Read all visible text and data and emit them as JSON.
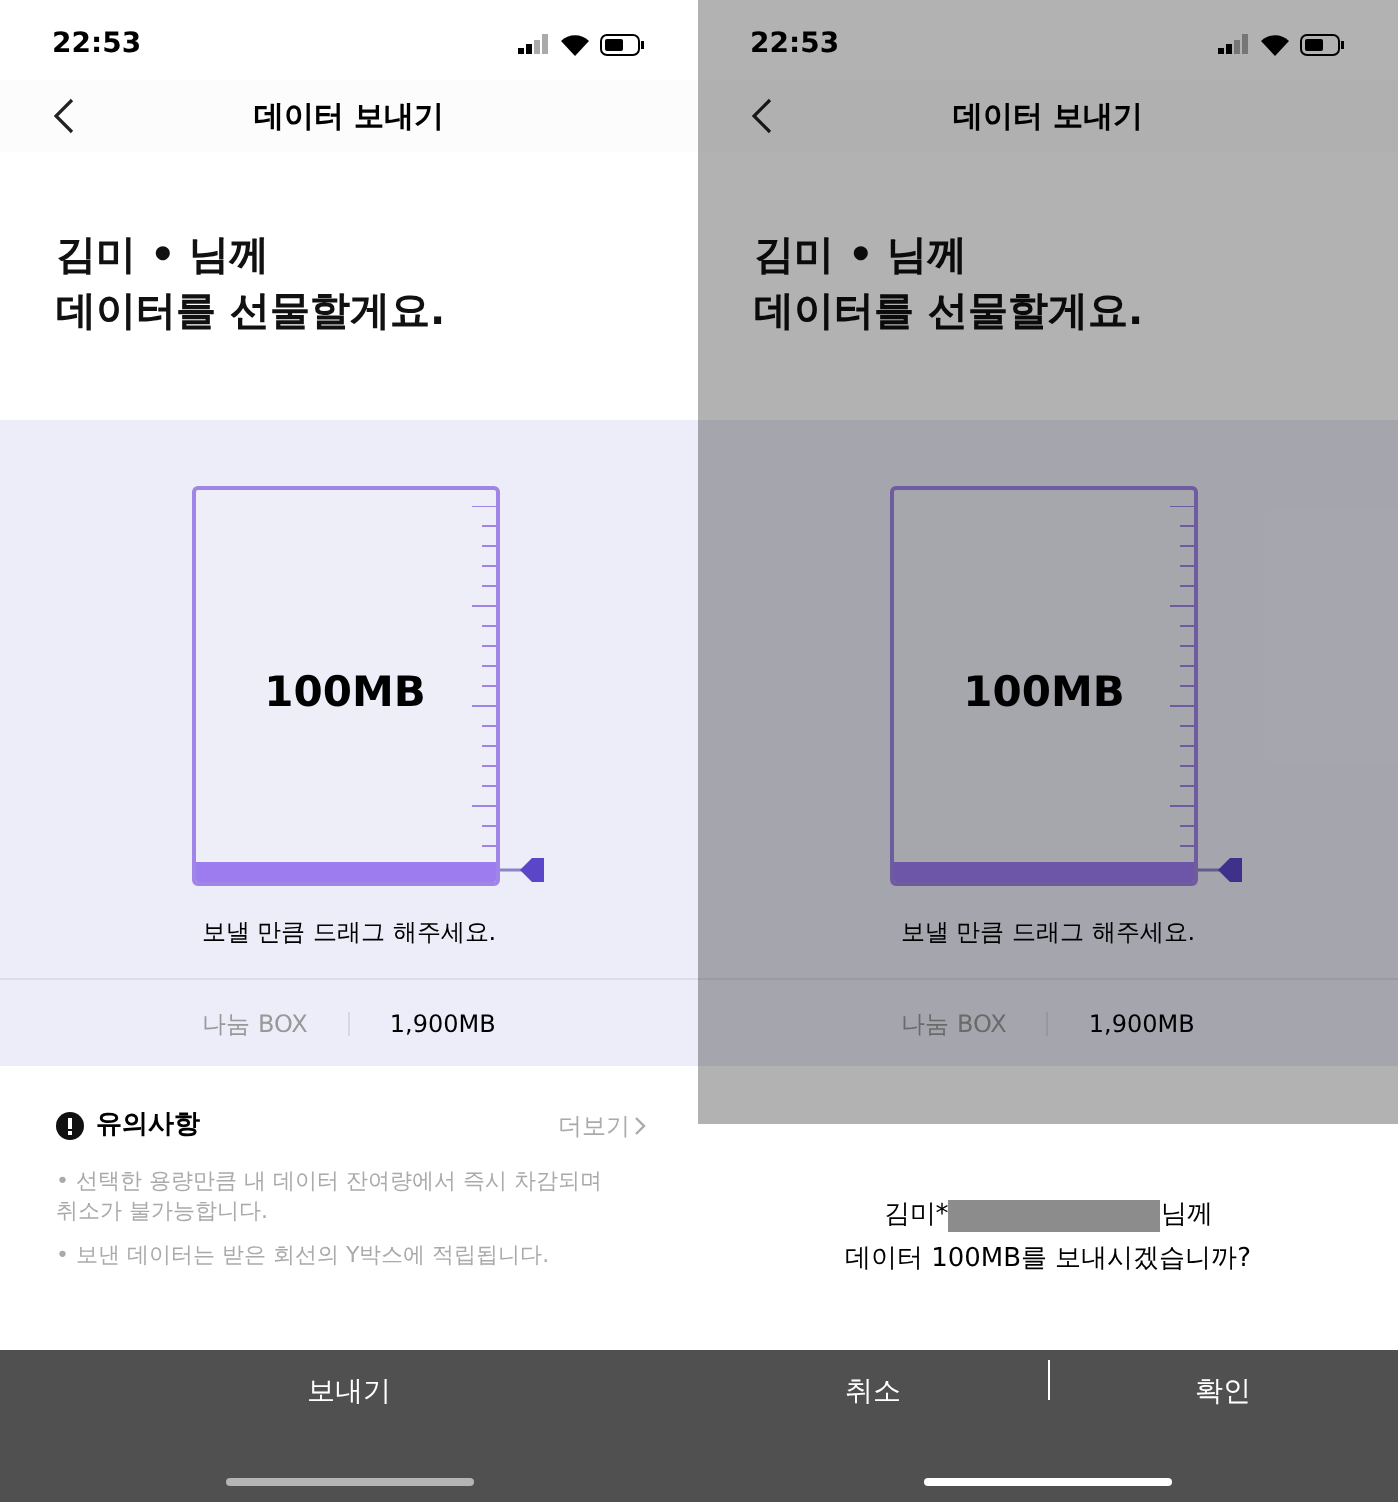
{
  "screens": [
    {
      "dimmed": false,
      "status_bar": {
        "time": "22:53"
      },
      "title": "데이터 보내기",
      "heading": [
        "김미 • 님께",
        "데이터를 선물할게요."
      ],
      "gauge": {
        "amount": "100MB",
        "level": 0.05,
        "hint": "보낼 만큼 드래그 해주세요."
      },
      "box": {
        "label": "나눔 BOX",
        "value": "1,900MB"
      },
      "notice": {
        "title": "유의사항",
        "more": "더보기",
        "items": [
          "• 선택한 용량만큼 내 데이터 잔여량에서 즉시 차감되며 취소가 불가능합니다.",
          "• 보낸 데이터는 받은 회선의 Y박스에 적립됩니다."
        ]
      },
      "actions": [
        "보내기"
      ]
    },
    {
      "dimmed": true,
      "status_bar": {
        "time": "22:53"
      },
      "title": "데이터 보내기",
      "heading": [
        "김미 • 님께",
        "데이터를 선물할게요."
      ],
      "gauge": {
        "amount": "100MB",
        "level": 0.05,
        "hint": "보낼 만큼 드래그 해주세요."
      },
      "box": {
        "label": "나눔 BOX",
        "value": "1,900MB"
      },
      "dialog": {
        "name_start": "김미*",
        "name_end": "님께",
        "question": "데이터 100MB를 보내시겠습니까?"
      },
      "actions": [
        "취소",
        "확인"
      ]
    }
  ]
}
